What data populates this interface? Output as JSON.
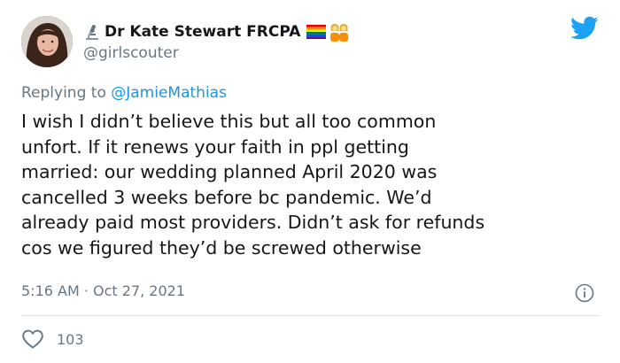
{
  "author": {
    "display_name": "Dr Kate Stewart FRCPA",
    "handle": "@girlscouter"
  },
  "reply": {
    "prefix": "Replying to",
    "mention": "@JamieMathias"
  },
  "tweet": {
    "lines": [
      "I wish I didn’t believe this but all too common",
      "unfort. If it renews your faith in ppl getting",
      "married: our wedding planned April 2020 was",
      "cancelled 3 weeks before bc pandemic. We’d",
      "already paid most providers. Didn’t ask for refunds",
      "cos we figured they’d be screwed otherwise"
    ],
    "timestamp": "5:16 AM · Oct 27, 2021"
  },
  "stats": {
    "likes": "103"
  },
  "icons": {
    "brand": "twitter-bird-icon",
    "name_prefix": "microscope-icon",
    "name_suffix": [
      "rainbow-flag-icon",
      "two-women-icon"
    ],
    "info": "info-icon",
    "like": "heart-icon"
  },
  "colors": {
    "twitter_blue": "#1da1f2",
    "mention_blue": "#1b95e0",
    "secondary_text": "#657786",
    "divider": "#e1e8ed"
  }
}
